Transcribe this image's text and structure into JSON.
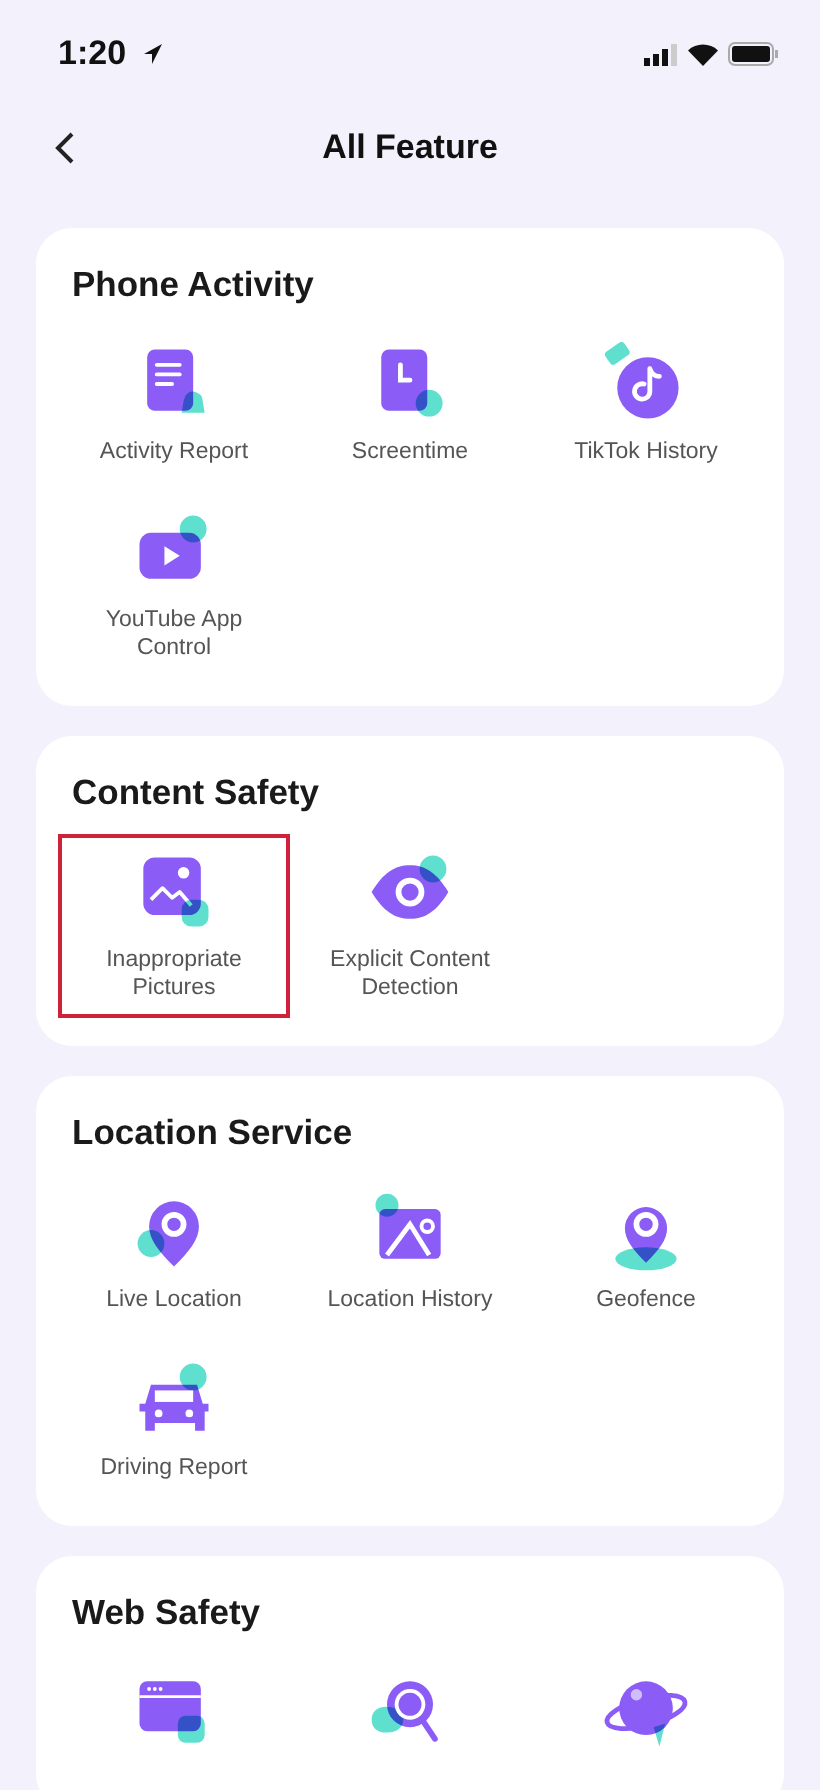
{
  "status_bar": {
    "time": "1:20"
  },
  "header": {
    "title": "All Feature"
  },
  "sections": [
    {
      "title": "Phone Activity",
      "items": [
        {
          "label": "Activity Report",
          "selected": false
        },
        {
          "label": "Screentime",
          "selected": false
        },
        {
          "label": "TikTok History",
          "selected": false
        },
        {
          "label": "YouTube App Control",
          "selected": false
        }
      ]
    },
    {
      "title": "Content Safety",
      "items": [
        {
          "label": "Inappropriate Pictures",
          "selected": true
        },
        {
          "label": "Explicit Content Detection",
          "selected": false
        }
      ]
    },
    {
      "title": "Location Service",
      "items": [
        {
          "label": "Live Location",
          "selected": false
        },
        {
          "label": "Location History",
          "selected": false
        },
        {
          "label": "Geofence",
          "selected": false
        },
        {
          "label": "Driving Report",
          "selected": false
        }
      ]
    },
    {
      "title": "Web Safety",
      "items": [
        {
          "selected": false
        },
        {
          "selected": false
        },
        {
          "selected": false
        }
      ]
    }
  ]
}
